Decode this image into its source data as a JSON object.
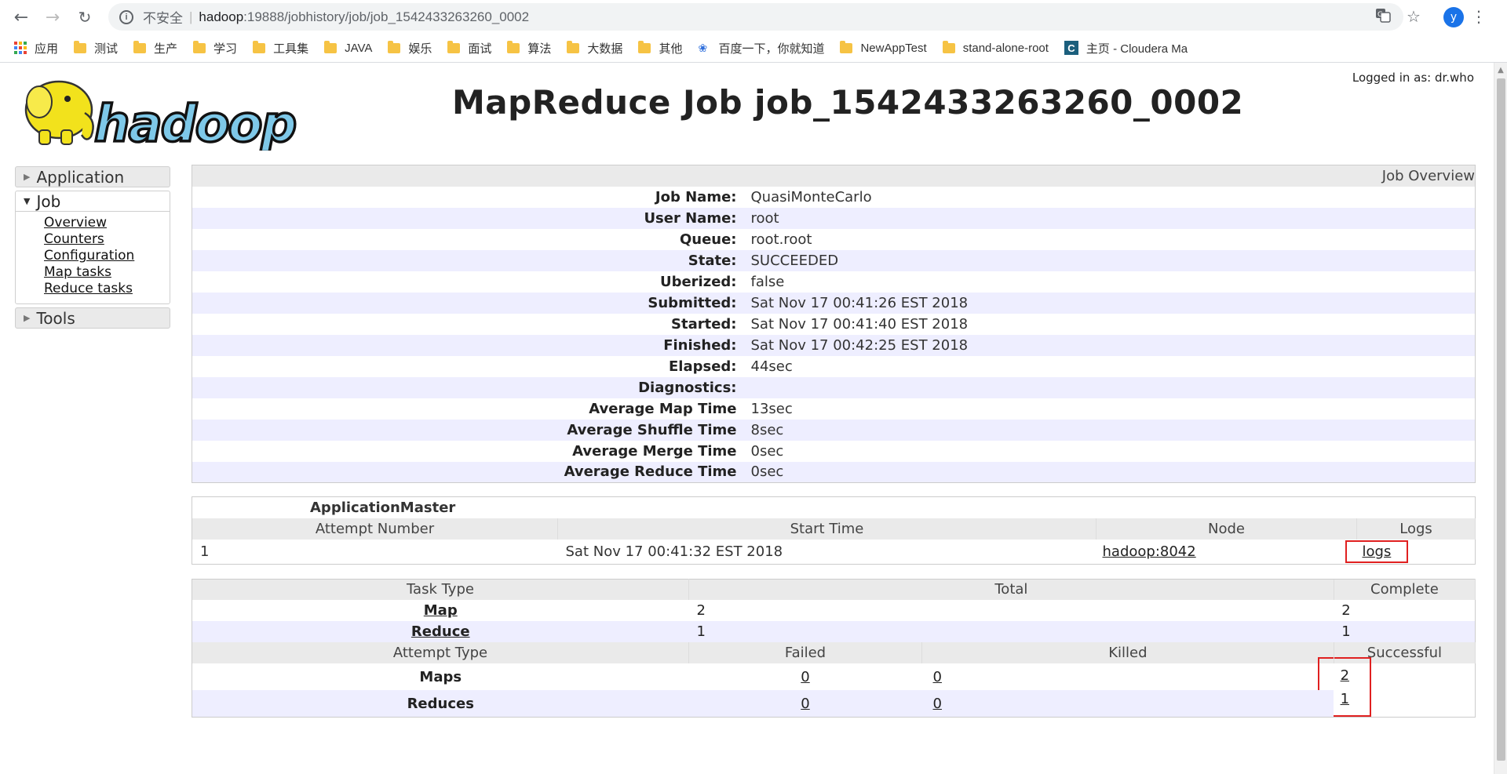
{
  "browser": {
    "insecure_label": "不安全",
    "url_host": "hadoop",
    "url_path": ":19888/jobhistory/job/job_1542433263260_0002",
    "avatar_letter": "y",
    "bookmarks": [
      "应用",
      "测试",
      "生产",
      "学习",
      "工具集",
      "JAVA",
      "娱乐",
      "面试",
      "算法",
      "大数据",
      "其他",
      "百度一下，你就知道",
      "NewAppTest",
      "stand-alone-root",
      "主页 - Cloudera Ma"
    ]
  },
  "header": {
    "logged_in": "Logged in as: dr.who",
    "title": "MapReduce Job job_1542433263260_0002",
    "logo_text": "hadoop"
  },
  "sidebar": {
    "application": "Application",
    "job": "Job",
    "job_links": [
      "Overview",
      "Counters",
      "Configuration",
      "Map tasks",
      "Reduce tasks"
    ],
    "tools": "Tools"
  },
  "overview": {
    "heading": "Job Overview",
    "rows": [
      {
        "label": "Job Name:",
        "value": "QuasiMonteCarlo"
      },
      {
        "label": "User Name:",
        "value": "root"
      },
      {
        "label": "Queue:",
        "value": "root.root"
      },
      {
        "label": "State:",
        "value": "SUCCEEDED"
      },
      {
        "label": "Uberized:",
        "value": "false"
      },
      {
        "label": "Submitted:",
        "value": "Sat Nov 17 00:41:26 EST 2018"
      },
      {
        "label": "Started:",
        "value": "Sat Nov 17 00:41:40 EST 2018"
      },
      {
        "label": "Finished:",
        "value": "Sat Nov 17 00:42:25 EST 2018"
      },
      {
        "label": "Elapsed:",
        "value": "44sec"
      },
      {
        "label": "Diagnostics:",
        "value": ""
      },
      {
        "label": "Average Map Time",
        "value": "13sec"
      },
      {
        "label": "Average Shuffle Time",
        "value": "8sec"
      },
      {
        "label": "Average Merge Time",
        "value": "0sec"
      },
      {
        "label": "Average Reduce Time",
        "value": "0sec"
      }
    ]
  },
  "app_master": {
    "caption": "ApplicationMaster",
    "columns": [
      "Attempt Number",
      "Start Time",
      "Node",
      "Logs"
    ],
    "row": {
      "attempt": "1",
      "start_time": "Sat Nov 17 00:41:32 EST 2018",
      "node": "hadoop:8042",
      "logs": "logs"
    }
  },
  "tasks": {
    "columns": [
      "Task Type",
      "Total",
      "Complete"
    ],
    "rows": [
      {
        "type": "Map",
        "total": "2",
        "complete": "2"
      },
      {
        "type": "Reduce",
        "total": "1",
        "complete": "1"
      }
    ],
    "attempt_columns": [
      "Attempt Type",
      "Failed",
      "Killed",
      "Successful"
    ],
    "attempt_rows": [
      {
        "type": "Maps",
        "failed": "0",
        "killed": "0",
        "successful": "2"
      },
      {
        "type": "Reduces",
        "failed": "0",
        "killed": "0",
        "successful": "1"
      }
    ]
  }
}
